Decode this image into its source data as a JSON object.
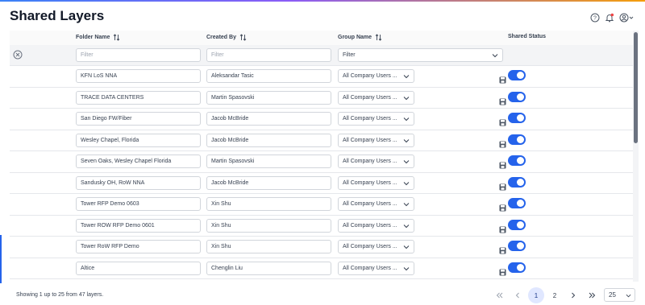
{
  "page": {
    "title": "Shared Layers"
  },
  "columns": {
    "folder": "Folder Name",
    "created_by": "Created By",
    "group": "Group Name",
    "shared": "Shared Status"
  },
  "filters": {
    "folder_placeholder": "Filter",
    "created_placeholder": "Filter",
    "group_value": "Filter"
  },
  "rows": [
    {
      "folder": "KFN LoS NNA",
      "created_by": "Aleksandar Tasic",
      "group": "All Company Users ...",
      "shared": true
    },
    {
      "folder": "TRACE DATA CENTERS",
      "created_by": "Martin Spasovski",
      "group": "All Company Users ...",
      "shared": true
    },
    {
      "folder": "San Diego FW/Fiber",
      "created_by": "Jacob McBride",
      "group": "All Company Users ...",
      "shared": true
    },
    {
      "folder": "Wesley Chapel, Florida",
      "created_by": "Jacob McBride",
      "group": "All Company Users ...",
      "shared": true
    },
    {
      "folder": "Seven Oaks, Wesley Chapel Florida",
      "created_by": "Martin Spasovski",
      "group": "All Company Users ...",
      "shared": true
    },
    {
      "folder": "Sandusky OH, RoW NNA",
      "created_by": "Jacob McBride",
      "group": "All Company Users ...",
      "shared": true
    },
    {
      "folder": "Tower RFP Demo 0603",
      "created_by": "Xin Shu",
      "group": "All Company Users ...",
      "shared": true
    },
    {
      "folder": "Tower ROW RFP Demo 0601",
      "created_by": "Xin Shu",
      "group": "All Company Users ...",
      "shared": true
    },
    {
      "folder": "Tower RoW RFP Demo",
      "created_by": "Xin Shu",
      "group": "All Company Users ...",
      "shared": true
    },
    {
      "folder": "Altice",
      "created_by": "Chenglin Liu",
      "group": "All Company Users ...",
      "shared": true
    },
    {
      "folder": "",
      "created_by": "",
      "group": "",
      "shared": true
    }
  ],
  "footer": {
    "showing": "Showing 1 up to 25 from 47 layers.",
    "pages": [
      "1",
      "2"
    ],
    "current_page": "1",
    "page_size": "25"
  },
  "colors": {
    "accent": "#2563eb",
    "active_page_bg": "#e0e7ff"
  },
  "icons": [
    "help-icon",
    "bell-icon",
    "user-icon",
    "sort-icon",
    "clear-filter-icon",
    "save-icon",
    "chevron-down-icon",
    "first-page-icon",
    "prev-page-icon",
    "next-page-icon",
    "last-page-icon"
  ]
}
